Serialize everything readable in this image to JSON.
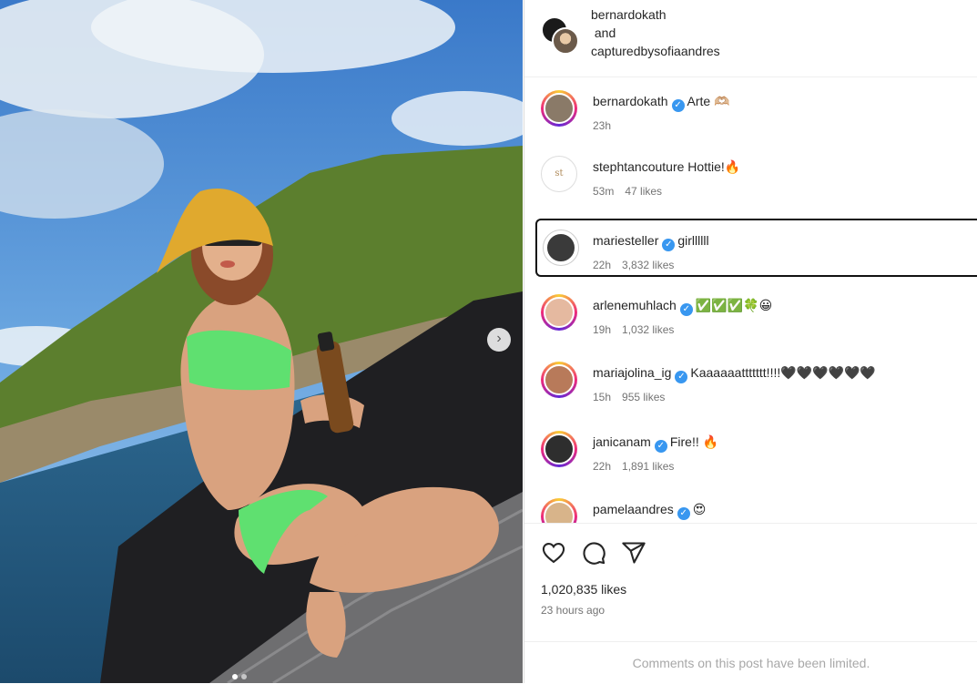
{
  "post": {
    "image_alt": "Woman in yellow bucket hat and green bikini crouching on a boat deck, island and sea behind",
    "carousel_dots": 2,
    "carousel_active": 0
  },
  "header": {
    "line1": "bernardokath",
    "line2": " and",
    "line3": "capturedbysofiaandres"
  },
  "comments": [
    {
      "user": "bernardokath",
      "verified": true,
      "text": "Arte 🫶🏼",
      "time": "23h",
      "likes": "",
      "ring": true,
      "avatar_color": "#8a7a68"
    },
    {
      "user": "stephtancouture",
      "verified": false,
      "text": "Hottie!🔥",
      "time": "53m",
      "likes": "47 likes",
      "ring": false,
      "avatar_color": "#ffffff"
    },
    {
      "user": "mariesteller",
      "verified": true,
      "text": "girllllll",
      "time": "22h",
      "likes": "3,832 likes",
      "ring": false,
      "avatar_color": "#3a3a3a"
    },
    {
      "user": "arlenemuhlach",
      "verified": true,
      "text": "✅✅✅🍀😀",
      "time": "19h",
      "likes": "1,032 likes",
      "ring": true,
      "avatar_color": "#e5b9a0"
    },
    {
      "user": "mariajolina_ig",
      "verified": true,
      "text": "Kaaaaaattttttt!!!!🖤🖤🖤🖤🖤🖤",
      "time": "15h",
      "likes": "955 likes",
      "ring": true,
      "avatar_color": "#b87a5a"
    },
    {
      "user": "janicanam",
      "verified": true,
      "text": "Fire!! 🔥",
      "time": "22h",
      "likes": "1,891 likes",
      "ring": true,
      "avatar_color": "#2e2e2e"
    },
    {
      "user": "pamelaandres",
      "verified": true,
      "text": "😍",
      "time": "",
      "likes": "",
      "ring": true,
      "avatar_color": "#d8b48a"
    }
  ],
  "actions": {
    "like_icon": "heart-icon",
    "comment_icon": "comment-icon",
    "share_icon": "share-icon",
    "likes": "1,020,835 likes",
    "time": "23 hours ago"
  },
  "footer": {
    "limited_text": "Comments on this post have been limited."
  }
}
